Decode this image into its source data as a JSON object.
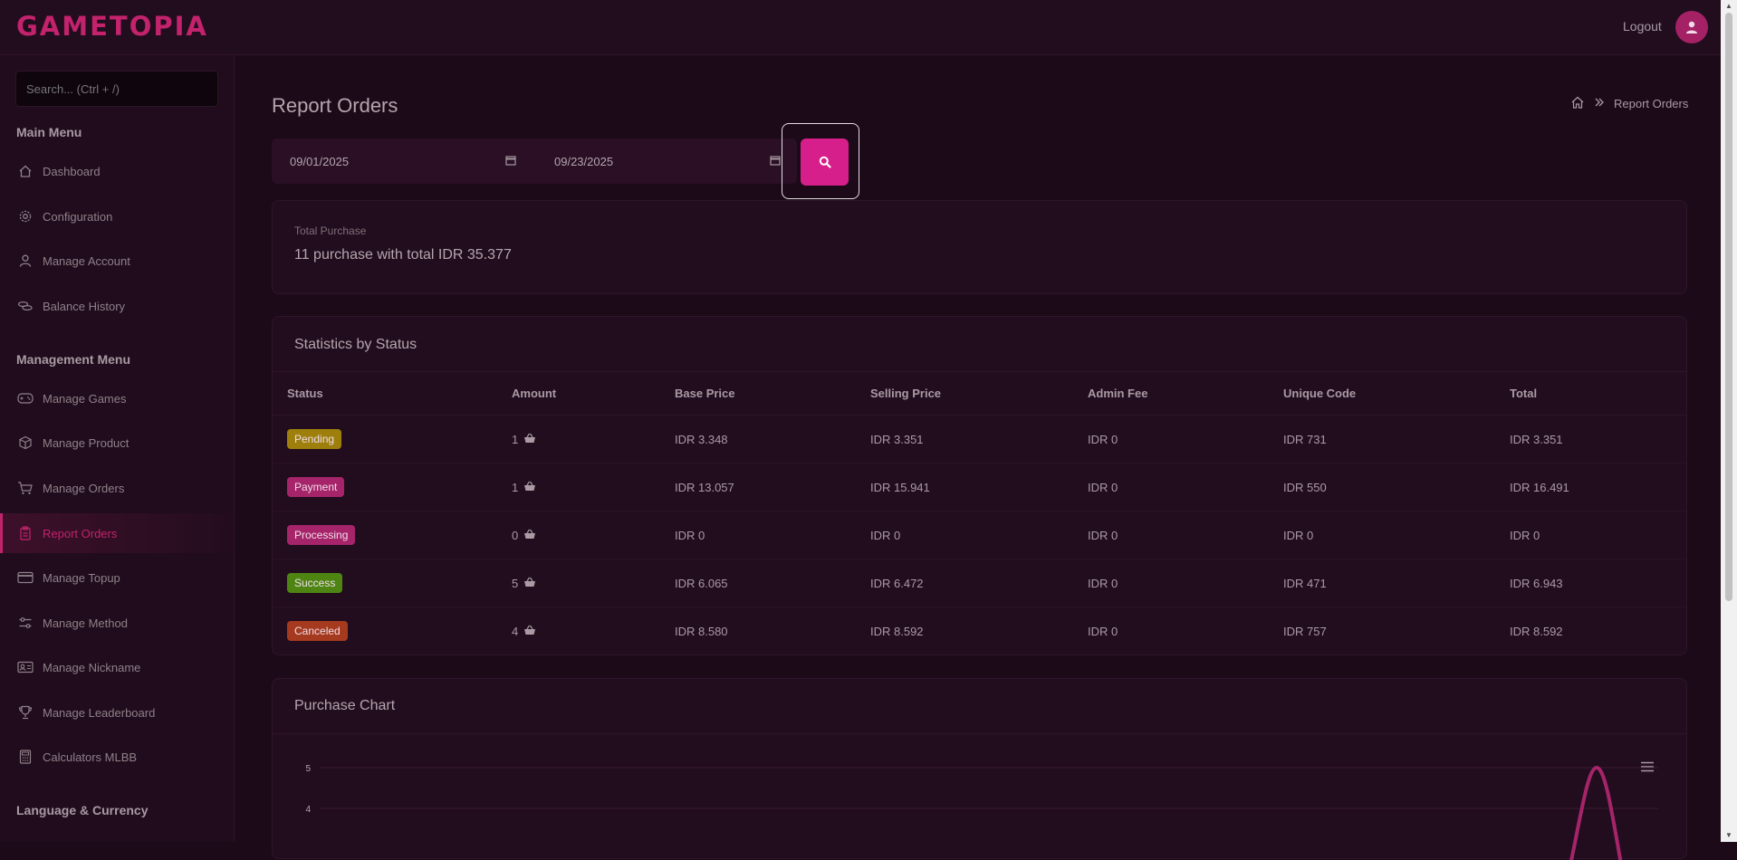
{
  "header": {
    "logo": "GAMETOPIA",
    "logout_label": "Logout"
  },
  "sidebar": {
    "search_placeholder": "Search... (Ctrl + /)",
    "sections": [
      "Main Menu",
      "Management Menu",
      "Language & Currency"
    ],
    "main_items": [
      {
        "label": "Dashboard",
        "icon": "home-icon"
      },
      {
        "label": "Configuration",
        "icon": "gear-icon"
      },
      {
        "label": "Manage Account",
        "icon": "user-icon"
      },
      {
        "label": "Balance History",
        "icon": "coins-icon"
      }
    ],
    "management_items": [
      {
        "label": "Manage Games",
        "icon": "gamepad-icon"
      },
      {
        "label": "Manage Product",
        "icon": "box-icon"
      },
      {
        "label": "Manage Orders",
        "icon": "cart-icon"
      },
      {
        "label": "Report Orders",
        "icon": "clipboard-icon",
        "active": true
      },
      {
        "label": "Manage Topup",
        "icon": "card-icon"
      },
      {
        "label": "Manage Method",
        "icon": "sliders-icon"
      },
      {
        "label": "Manage Nickname",
        "icon": "id-card-icon"
      },
      {
        "label": "Manage Leaderboard",
        "icon": "trophy-icon"
      },
      {
        "label": "Calculators MLBB",
        "icon": "calculator-icon"
      }
    ]
  },
  "page": {
    "title": "Report Orders",
    "breadcrumb": "Report Orders",
    "date_from": "09/01/2025",
    "date_to": "09/23/2025"
  },
  "summary": {
    "label": "Total Purchase",
    "value": "11 purchase with total IDR 35.377"
  },
  "stats": {
    "title": "Statistics by Status",
    "columns": [
      "Status",
      "Amount",
      "Base Price",
      "Selling Price",
      "Admin Fee",
      "Unique Code",
      "Total"
    ],
    "rows": [
      {
        "status": "Pending",
        "color": "#9e7f0b",
        "amount": "1",
        "base": "IDR 3.348",
        "selling": "IDR 3.351",
        "admin": "IDR 0",
        "unique": "IDR 731",
        "total": "IDR 3.351"
      },
      {
        "status": "Payment",
        "color": "#a6246a",
        "amount": "1",
        "base": "IDR 13.057",
        "selling": "IDR 15.941",
        "admin": "IDR 0",
        "unique": "IDR 550",
        "total": "IDR 16.491"
      },
      {
        "status": "Processing",
        "color": "#a6246a",
        "amount": "0",
        "base": "IDR 0",
        "selling": "IDR 0",
        "admin": "IDR 0",
        "unique": "IDR 0",
        "total": "IDR 0"
      },
      {
        "status": "Success",
        "color": "#4e8512",
        "amount": "5",
        "base": "IDR 6.065",
        "selling": "IDR 6.472",
        "admin": "IDR 0",
        "unique": "IDR 471",
        "total": "IDR 6.943"
      },
      {
        "status": "Canceled",
        "color": "#a53a1e",
        "amount": "4",
        "base": "IDR 8.580",
        "selling": "IDR 8.592",
        "admin": "IDR 0",
        "unique": "IDR 757",
        "total": "IDR 8.592"
      }
    ]
  },
  "chart": {
    "title": "Purchase Chart",
    "y_ticks": [
      "5",
      "4"
    ],
    "peak_value": 5,
    "line_color": "#a6246a"
  },
  "colors": {
    "accent": "#c3226c",
    "button": "#d61f8a",
    "background": "#1c0a18"
  }
}
